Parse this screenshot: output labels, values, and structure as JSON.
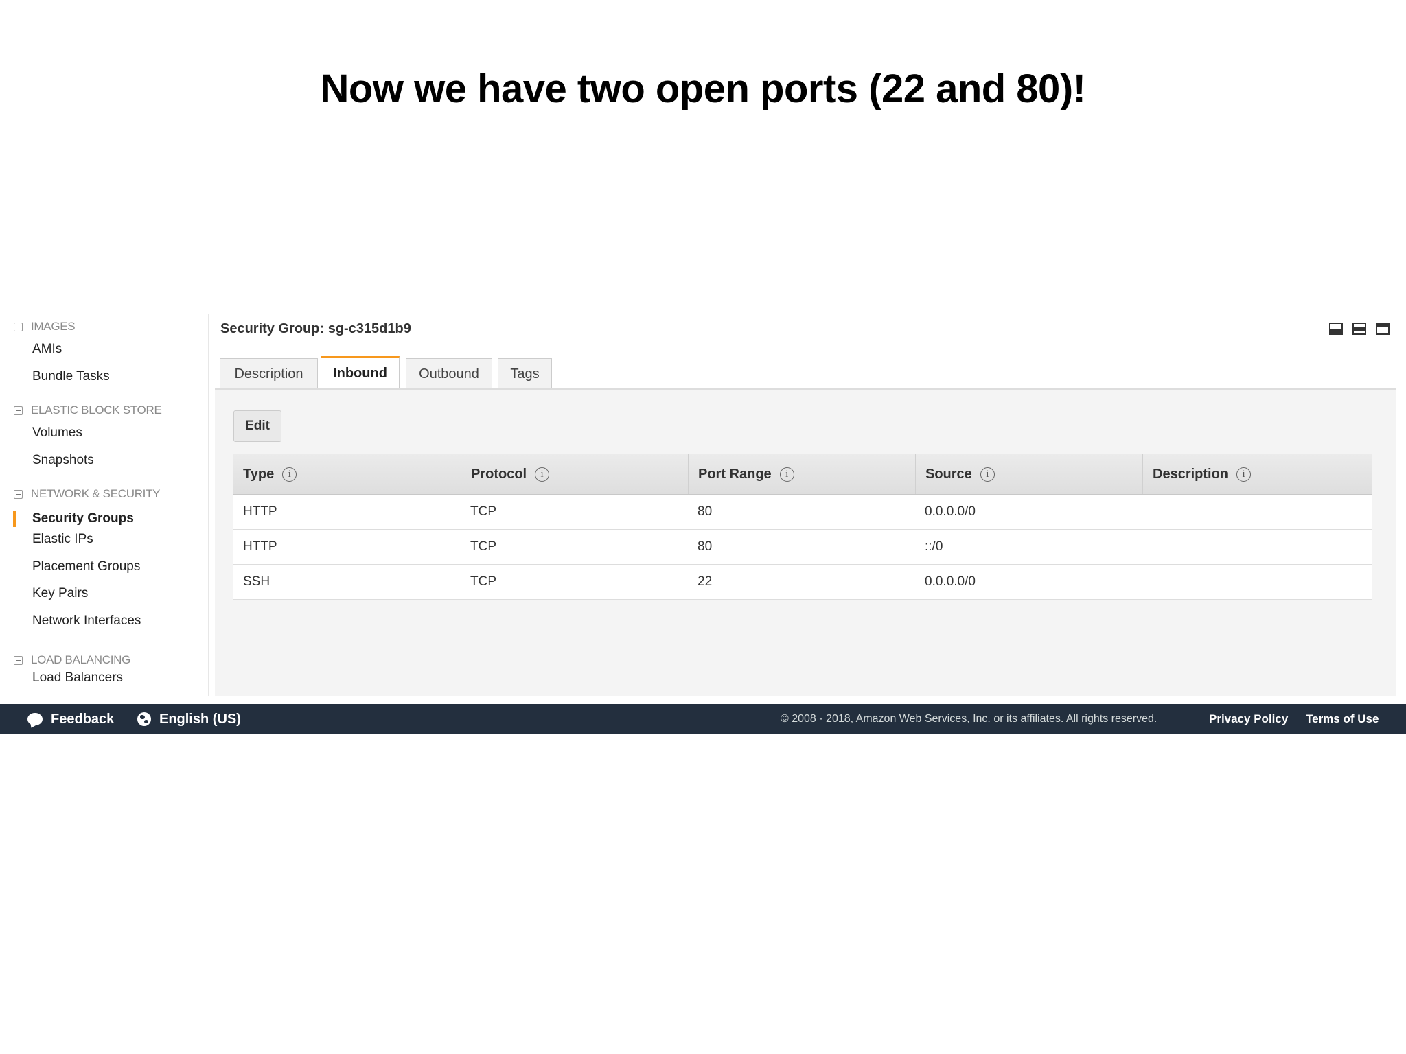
{
  "slide": {
    "title": "Now we have two open ports (22 and 80)!"
  },
  "sidebar": {
    "sections": [
      {
        "label": "IMAGES",
        "items": [
          "AMIs",
          "Bundle Tasks"
        ]
      },
      {
        "label": "ELASTIC BLOCK STORE",
        "items": [
          "Volumes",
          "Snapshots"
        ]
      },
      {
        "label": "NETWORK & SECURITY",
        "items": [
          "Security Groups",
          "Elastic IPs",
          "Placement Groups",
          "Key Pairs",
          "Network Interfaces"
        ]
      },
      {
        "label": "LOAD BALANCING",
        "items": [
          "Load Balancers"
        ]
      }
    ],
    "active_item": "Security Groups",
    "accent_color": "#f7981d"
  },
  "content": {
    "title": "Security Group: sg-c315d1b9",
    "tabs": [
      "Description",
      "Inbound",
      "Outbound",
      "Tags"
    ],
    "active_tab": "Inbound",
    "edit_label": "Edit",
    "columns": [
      "Type",
      "Protocol",
      "Port Range",
      "Source",
      "Description"
    ],
    "rows": [
      [
        "HTTP",
        "TCP",
        "80",
        "0.0.0.0/0",
        ""
      ],
      [
        "HTTP",
        "TCP",
        "80",
        "::/0",
        ""
      ],
      [
        "SSH",
        "TCP",
        "22",
        "0.0.0.0/0",
        ""
      ]
    ]
  },
  "footer": {
    "feedback": "Feedback",
    "language": "English (US)",
    "copyright": "© 2008 - 2018, Amazon Web Services, Inc. or its affiliates. All rights reserved.",
    "privacy": "Privacy Policy",
    "terms": "Terms of Use",
    "background_color": "#232f3e"
  }
}
